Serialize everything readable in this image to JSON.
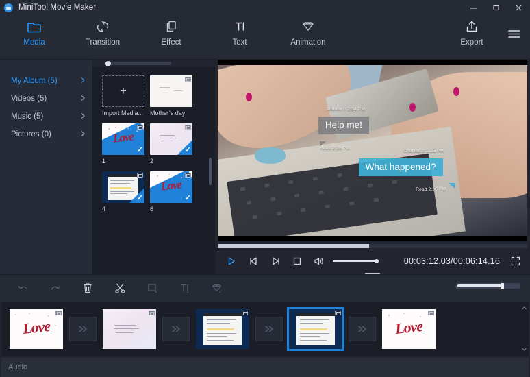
{
  "window": {
    "title": "MiniTool Movie Maker",
    "controls": [
      {
        "name": "minimize",
        "label": "—"
      },
      {
        "name": "maximize",
        "label": "□"
      },
      {
        "name": "close",
        "label": "✕"
      }
    ]
  },
  "nav": {
    "items": [
      {
        "id": "media",
        "label": "Media",
        "icon": "folder-icon",
        "active": true
      },
      {
        "id": "transition",
        "label": "Transition",
        "icon": "transition-icon",
        "active": false
      },
      {
        "id": "effect",
        "label": "Effect",
        "icon": "effect-icon",
        "active": false
      },
      {
        "id": "text",
        "label": "Text",
        "icon": "text-icon",
        "active": false
      },
      {
        "id": "animation",
        "label": "Animation",
        "icon": "animation-icon",
        "active": false
      },
      {
        "id": "export",
        "label": "Export",
        "icon": "export-icon",
        "active": false
      }
    ],
    "menu_icon": "hamburger-icon"
  },
  "sidebar": {
    "items": [
      {
        "label": "My Album (5)",
        "active": true
      },
      {
        "label": "Videos (5)",
        "active": false
      },
      {
        "label": "Music (5)",
        "active": false
      },
      {
        "label": "Pictures (0)",
        "active": false
      }
    ],
    "chevron_icon": "chevron-right-icon"
  },
  "media": {
    "items": [
      {
        "caption": "Import Media...",
        "type": "import",
        "checked": false
      },
      {
        "caption": "Mother's day",
        "type": "white",
        "checked": false
      },
      {
        "caption": "1",
        "type": "love",
        "checked": true
      },
      {
        "caption": "2",
        "type": "text",
        "checked": true
      },
      {
        "caption": "4",
        "type": "window",
        "checked": true
      },
      {
        "caption": "6",
        "type": "love",
        "checked": true
      }
    ]
  },
  "preview": {
    "overlays": [
      {
        "id": "sender1",
        "meta_top": "Andrew // 2:34 PM",
        "text": "Help me!",
        "meta_bottom": "Read 2:35 PM",
        "style": "grey"
      },
      {
        "id": "sender2",
        "meta_top": "Chelsea // 2:35 PM",
        "text": "What happened?",
        "meta_bottom": "Read 2:35 PM",
        "style": "blue"
      }
    ],
    "timecode": "00:03:12.03/00:06:14.16",
    "progress_percent": 49,
    "controls": [
      {
        "name": "play-button",
        "icon": "play-icon"
      },
      {
        "name": "previous-frame-button",
        "icon": "previous-frame-icon"
      },
      {
        "name": "next-frame-button",
        "icon": "next-frame-icon"
      },
      {
        "name": "stop-button",
        "icon": "stop-icon"
      },
      {
        "name": "volume-button",
        "icon": "speaker-icon"
      }
    ],
    "fullscreen_icon": "fullscreen-icon"
  },
  "edit_toolbar": {
    "buttons": [
      {
        "name": "undo-button",
        "icon": "undo-icon",
        "enabled": false
      },
      {
        "name": "redo-button",
        "icon": "redo-icon",
        "enabled": false
      },
      {
        "name": "delete-button",
        "icon": "trash-icon",
        "enabled": true
      },
      {
        "name": "split-button",
        "icon": "scissors-icon",
        "enabled": true
      },
      {
        "name": "crop-button",
        "icon": "crop-icon",
        "enabled": false
      },
      {
        "name": "text-edit-button",
        "icon": "text-icon",
        "enabled": false
      },
      {
        "name": "effect-edit-button",
        "icon": "diamond-icon",
        "enabled": false
      }
    ],
    "zoom_value_percent": 66
  },
  "timeline": {
    "clips": [
      {
        "id": "clip-1",
        "type": "love",
        "selected": false
      },
      {
        "id": "clip-2",
        "type": "text",
        "selected": false
      },
      {
        "id": "clip-3",
        "type": "window",
        "selected": false
      },
      {
        "id": "clip-4",
        "type": "window",
        "selected": true
      },
      {
        "id": "clip-5",
        "type": "love",
        "selected": false
      }
    ],
    "transition_icon": "transition-arrows-icon",
    "audio_track_label": "Audio",
    "scroll_up_icon": "caret-up-icon",
    "scroll_down_icon": "caret-down-icon"
  },
  "colors": {
    "accent": "#2e9bff",
    "selection": "#1f82d8",
    "titlebar_bg": "#262a35",
    "panel_bg": "#1b1e27",
    "sidebar_bg": "#262b38"
  }
}
